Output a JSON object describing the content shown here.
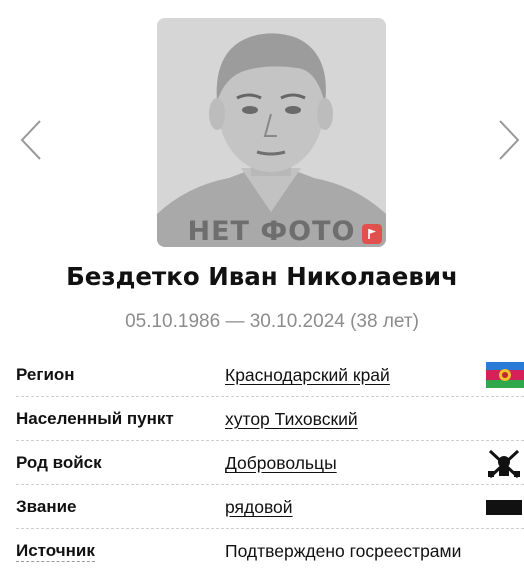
{
  "navigation": {
    "prev_icon": "chevron-left-icon",
    "next_icon": "chevron-right-icon"
  },
  "photo": {
    "placeholder_text": "НЕТ ФОТО",
    "report_icon": "flag-icon",
    "report_color": "#e0514e"
  },
  "person": {
    "name": "Бездетко Иван Николаевич",
    "dates": "05.10.1986 — 30.10.2024 (38 лет)"
  },
  "details": [
    {
      "label": "Регион",
      "value": "Краснодарский край",
      "is_link": true,
      "icon": "krasnodar-flag-icon"
    },
    {
      "label": "Населенный пункт",
      "value": "хутор Тиховский",
      "is_link": true,
      "icon": ""
    },
    {
      "label": "Род войск",
      "value": "Добровольцы",
      "is_link": true,
      "icon": "crossed-swords-emblem-icon"
    },
    {
      "label": "Звание",
      "value": "рядовой",
      "is_link": true,
      "icon": "rank-insignia-icon"
    },
    {
      "label": "Источник",
      "value": "Подтверждено госреестрами",
      "is_link": false,
      "icon": ""
    }
  ],
  "colors": {
    "text": "#111111",
    "muted": "#8c8c8c",
    "divider": "#cfcfcf"
  }
}
